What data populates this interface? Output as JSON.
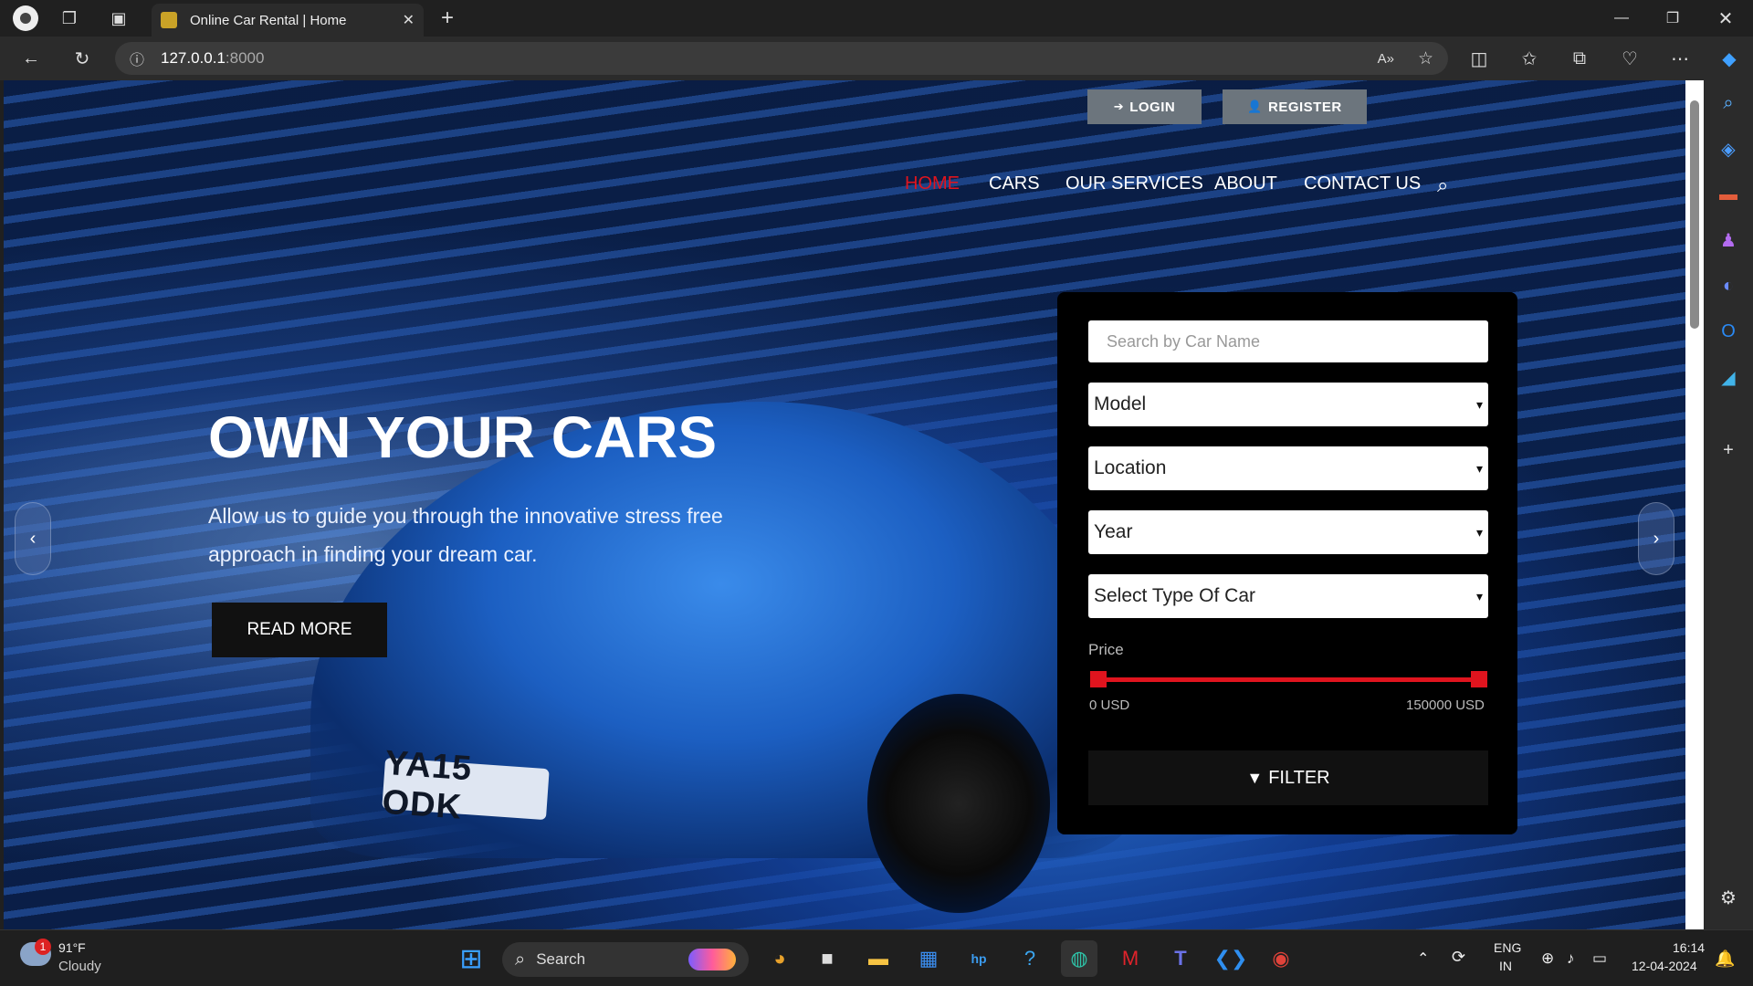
{
  "browser": {
    "tab_title": "Online Car Rental | Home",
    "url_host": "127.0.0.1",
    "url_port": ":8000",
    "new_tab": "+",
    "close_tab": "✕"
  },
  "site": {
    "login_label": "LOGIN",
    "register_label": "REGISTER",
    "menu": [
      "HOME",
      "CARS",
      "OUR SERVICES",
      "ABOUT",
      "CONTACT US"
    ],
    "active_menu_color": "#e0141e",
    "hero_title": "OWN YOUR CARS",
    "hero_subtitle": "Allow us to guide you through the innovative stress free approach in finding your dream car.",
    "read_more": "READ MORE",
    "plate": "YA15 ODK"
  },
  "filter": {
    "search_placeholder": "Search by Car Name",
    "model": "Model",
    "location": "Location",
    "year": "Year",
    "type": "Select Type Of Car",
    "price_label": "Price",
    "price_min": "0 USD",
    "price_max": "150000 USD",
    "filter_label": "FILTER",
    "accent": "#e0141e"
  },
  "taskbar": {
    "weather_temp": "91°F",
    "weather_desc": "Cloudy",
    "weather_badge": "1",
    "search_label": "Search",
    "lang_top": "ENG",
    "lang_bottom": "IN",
    "time": "16:14",
    "date": "12-04-2024"
  }
}
